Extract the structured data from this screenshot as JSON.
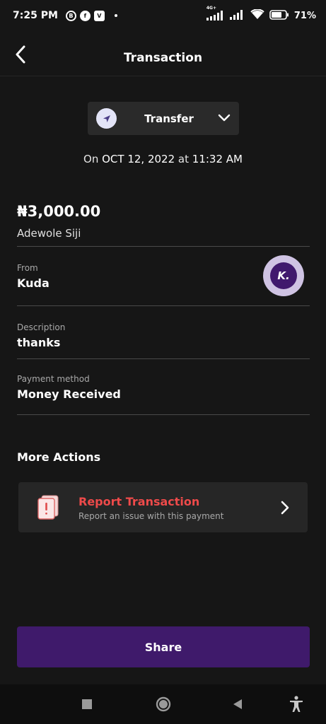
{
  "status_bar": {
    "time": "7:25 PM",
    "notification_icons": [
      "bitcoin-icon",
      "facebook-icon",
      "v-app-icon"
    ],
    "network_label": "4G+",
    "battery_percent": "71%"
  },
  "header": {
    "title": "Transaction",
    "back_icon": "chevron-left-icon"
  },
  "category": {
    "label": "Transfer",
    "icon": "send-arrow-icon",
    "dropdown_icon": "chevron-down-icon"
  },
  "date": {
    "prefix": "On",
    "date": "OCT 12, 2022",
    "connector": "at",
    "time": "11:32 AM"
  },
  "transaction": {
    "amount": "₦3,000.00",
    "counterparty": "Adewole Siji",
    "from_label": "From",
    "from_value": "Kuda",
    "bank_logo_text": "K.",
    "description_label": "Description",
    "description_value": "thanks",
    "payment_method_label": "Payment method",
    "payment_method_value": "Money Received"
  },
  "more_actions": {
    "title": "More Actions",
    "report": {
      "title": "Report Transaction",
      "subtitle": "Report an issue with this payment",
      "icon": "report-alert-icon",
      "chevron_icon": "chevron-right-icon"
    }
  },
  "share_button": {
    "label": "Share"
  },
  "colors": {
    "background": "#161616",
    "card": "#262626",
    "accent_purple": "#3f1a6b",
    "danger_red": "#ee4a4a",
    "logo_outer": "#cfc3e3",
    "logo_inner": "#40196d"
  },
  "nav_bar": {
    "buttons": [
      "recents-square-icon",
      "home-circle-icon",
      "back-triangle-icon",
      "accessibility-icon"
    ]
  }
}
